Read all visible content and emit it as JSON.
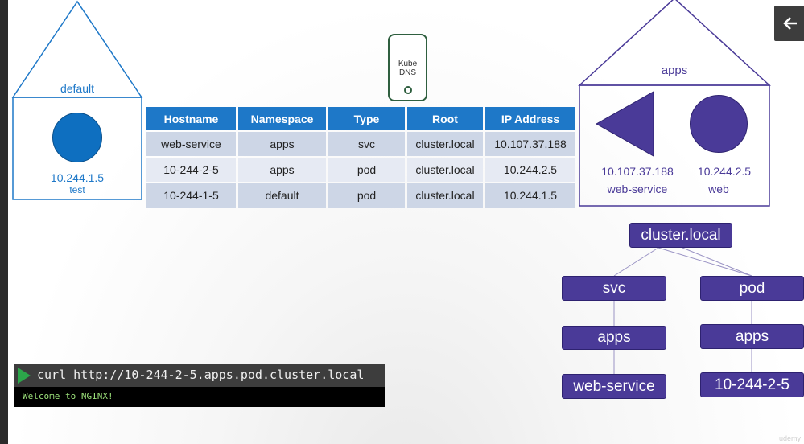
{
  "namespaces": {
    "default": {
      "label": "default",
      "pod_ip": "10.244.1.5",
      "pod_name": "test"
    },
    "apps": {
      "label": "apps",
      "service": {
        "ip": "10.107.37.188",
        "name": "web-service"
      },
      "pod": {
        "ip": "10.244.2.5",
        "name": "web"
      }
    }
  },
  "kube_dns": {
    "line1": "Kube",
    "line2": "DNS"
  },
  "table": {
    "headers": [
      "Hostname",
      "Namespace",
      "Type",
      "Root",
      "IP Address"
    ],
    "rows": [
      [
        "web-service",
        "apps",
        "svc",
        "cluster.local",
        "10.107.37.188"
      ],
      [
        "10-244-2-5",
        "apps",
        "pod",
        "cluster.local",
        "10.244.2.5"
      ],
      [
        "10-244-1-5",
        "default",
        "pod",
        "cluster.local",
        "10.244.1.5"
      ]
    ]
  },
  "tree": {
    "root": "cluster.local",
    "svc": "svc",
    "pod": "pod",
    "svc_ns": "apps",
    "pod_ns": "apps",
    "svc_leaf": "web-service",
    "pod_leaf": "10-244-2-5"
  },
  "terminal": {
    "command": "curl http://10-244-2-5.apps.pod.cluster.local",
    "output": "Welcome to NGINX!"
  },
  "watermark": "udemy",
  "colors": {
    "default_namespace": "#1e78c8",
    "apps_namespace": "#4a3a98",
    "table_header": "#1e78c8",
    "dns_border": "#2f5f3f",
    "terminal_prompt": "#2ca64a"
  },
  "icons": {
    "back": "arrow-left-icon",
    "play": "play-icon"
  }
}
